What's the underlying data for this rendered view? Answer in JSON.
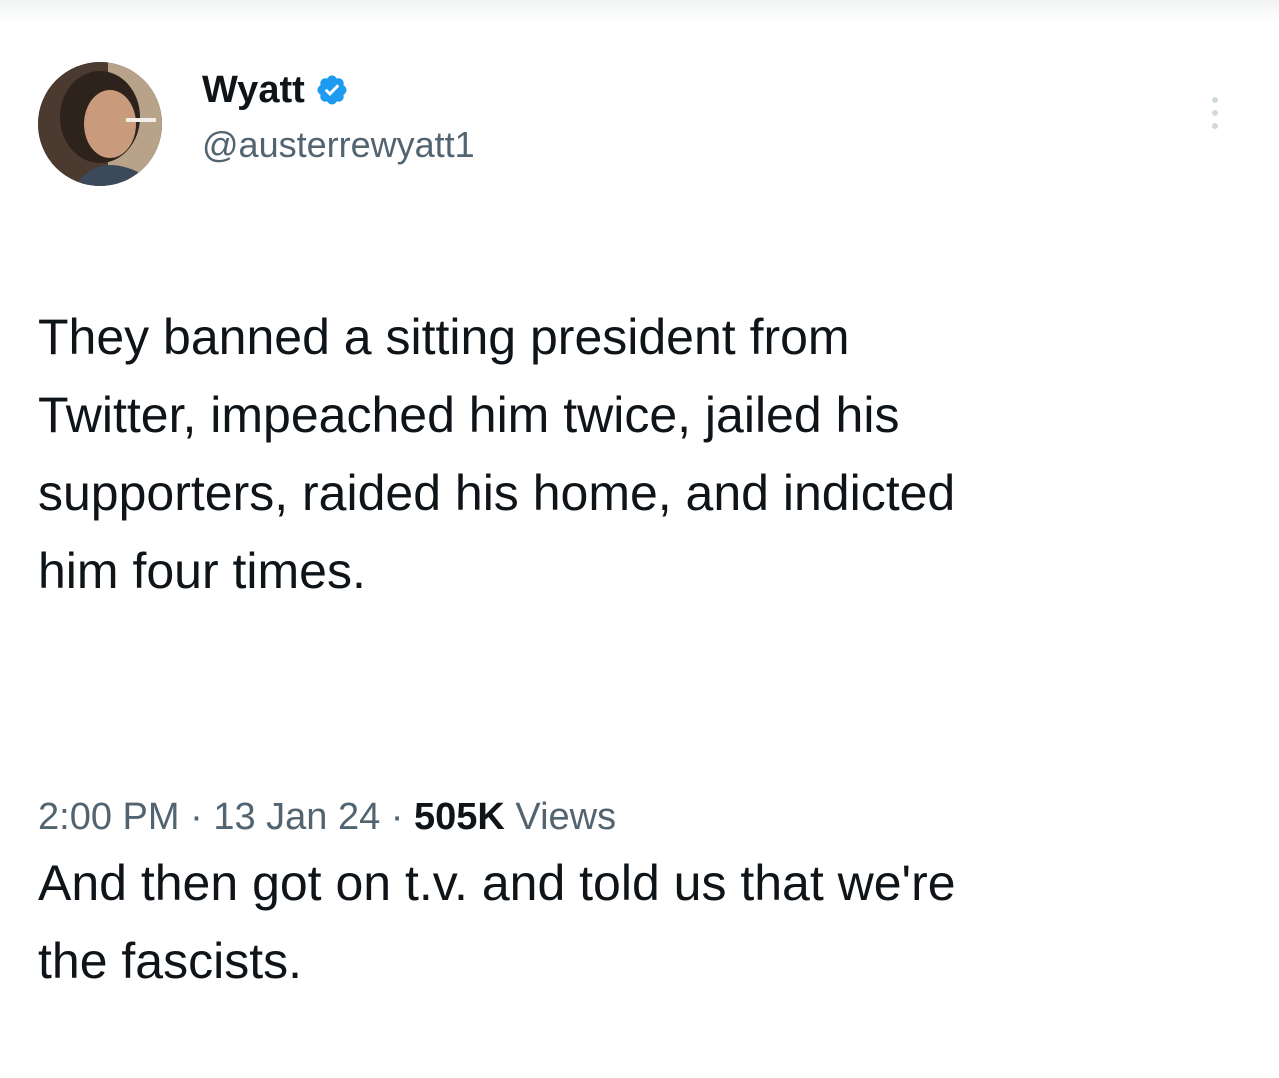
{
  "author": {
    "display_name": "Wyatt",
    "handle": "@austerrewyatt1",
    "verified": true,
    "verified_color": "#1d9bf0"
  },
  "tweet": {
    "paragraph_1": "They banned a sitting president from\nTwitter, impeached him twice, jailed his\nsupporters, raided his home, and indicted\nhim four times.",
    "paragraph_2": "And then got on t.v. and told us that we're\nthe fascists."
  },
  "meta": {
    "time": "2:00 PM",
    "separator": " · ",
    "date": "13 Jan 24",
    "views_count": "505K",
    "views_label": " Views"
  },
  "icons": {
    "verified": "verified-badge-icon",
    "more": "more-options-icon"
  },
  "colors": {
    "text_primary": "#0f1419",
    "text_secondary": "#536471",
    "accent": "#1d9bf0"
  }
}
